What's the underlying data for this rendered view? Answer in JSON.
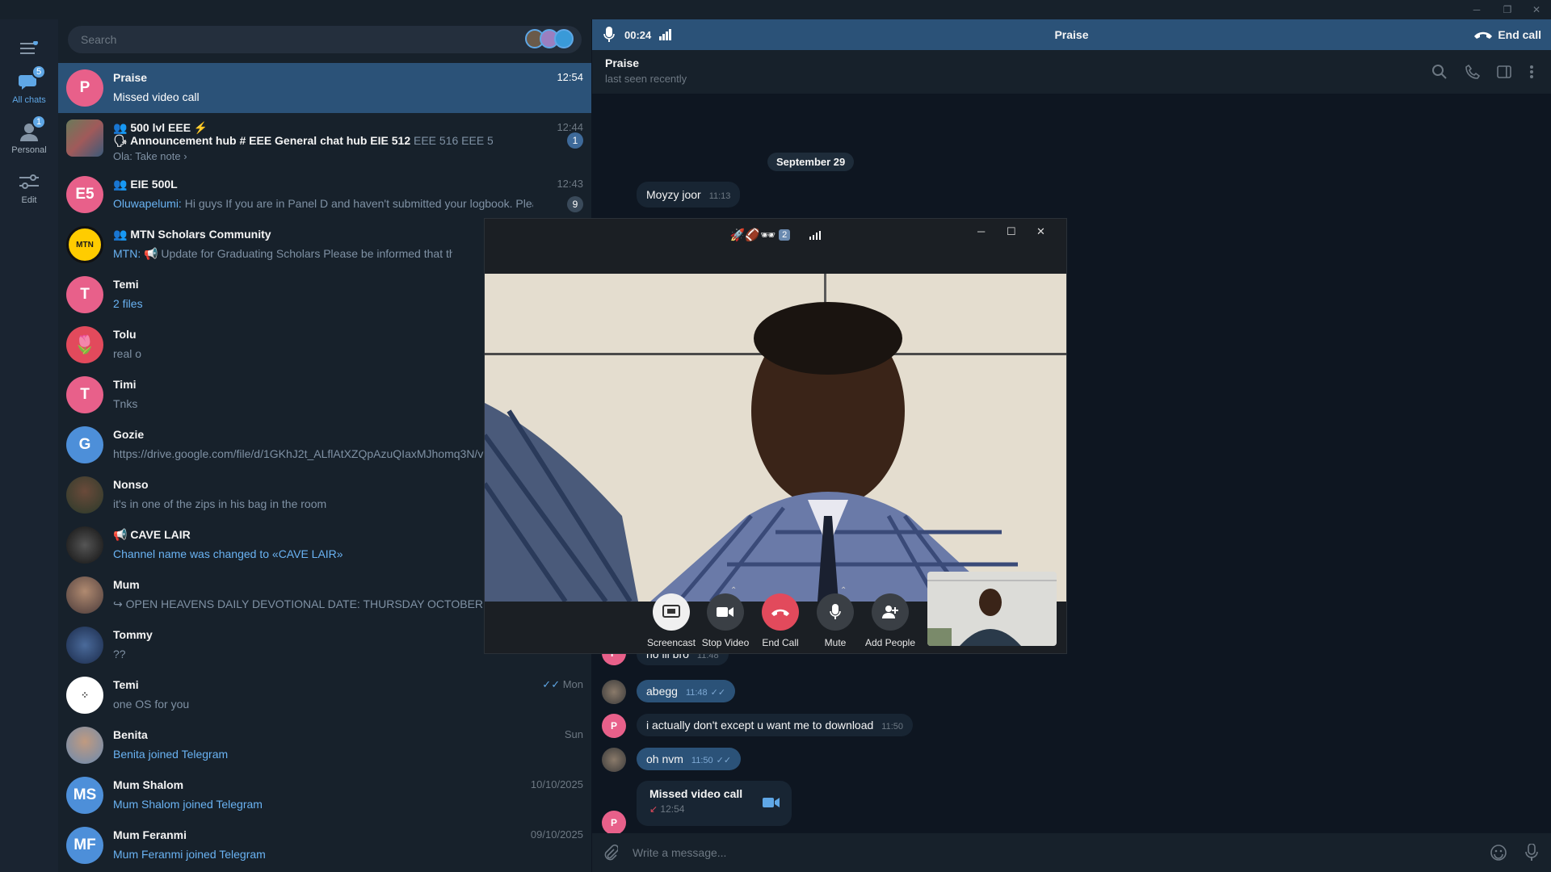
{
  "window": {
    "minimize": "─",
    "restore": "❐",
    "close": "✕"
  },
  "rail": {
    "items": [
      {
        "label": "All chats",
        "badge": "5"
      },
      {
        "label": "Personal",
        "badge": "1"
      },
      {
        "label": "Edit"
      }
    ]
  },
  "search": {
    "placeholder": "Search"
  },
  "chats": [
    {
      "name": "Praise",
      "preview": "Missed video call",
      "time": "12:54",
      "avatar_letter": "P",
      "avatar_color": "#e8608a"
    },
    {
      "name": "500 lvl EEE ⚡",
      "preview_prefix": "🗣 Announcement hub  # EEE General chat hub  EIE 512",
      "preview": "EEE 516  EEE 531  EEE 515  EDS ...",
      "sub_preview": "Ola: Take note ›",
      "time": "12:44",
      "unread": "1"
    },
    {
      "name": "EIE 500L",
      "preview_sender": "Oluwapelumi:",
      "preview": "Hi guys  If you are in Panel D and haven't submitted your logbook.  Please co...",
      "time": "12:43",
      "unread": "9",
      "avatar_letter": "E5",
      "avatar_color": "#e8608a"
    },
    {
      "name": "MTN Scholars Community",
      "preview_sender": "MTN:",
      "preview": "📢 Update for Graduating Scholars  Please be informed that the SkillUP",
      "avatar_letter": "MTN",
      "avatar_color": "#ffcc00"
    },
    {
      "name": "Temi",
      "preview": "2 files",
      "avatar_letter": "T",
      "avatar_color": "#e8608a"
    },
    {
      "name": "Tolu",
      "preview": "real o",
      "avatar_letter": "🌷",
      "avatar_color": "#e24a5c"
    },
    {
      "name": "Timi",
      "preview": "Tnks",
      "avatar_letter": "T",
      "avatar_color": "#e8608a"
    },
    {
      "name": "Gozie",
      "preview": "https://drive.google.com/file/d/1GKhJ2t_ALflAtXZQpAzuQIaxMJhomq3N/view",
      "avatar_letter": "G",
      "avatar_color": "#4d8fd9"
    },
    {
      "name": "Nonso",
      "preview": "it's in one of the zips in his bag in the room",
      "avatar_color": "#5a4a3a"
    },
    {
      "name": "📢 CAVE LAIR",
      "preview": "Channel name was changed to «CAVE LAIR»",
      "avatar_color": "#222"
    },
    {
      "name": "Mum",
      "preview": "↪ OPEN HEAVENS DAILY DEVOTIONAL   DATE: THURSDAY OCTOBER 16TH202",
      "avatar_color": "#8a6a5a"
    },
    {
      "name": "Tommy",
      "preview": "??",
      "avatar_color": "#3a4a6a"
    },
    {
      "name": "Temi",
      "preview": "one OS for you",
      "time": "Mon",
      "avatar_color": "#ffffff"
    },
    {
      "name": "Benita",
      "preview": "Benita joined Telegram",
      "time": "Sun",
      "avatar_color": "#7a6a8a"
    },
    {
      "name": "Mum Shalom",
      "preview": "Mum Shalom joined Telegram",
      "time": "10/10/2025",
      "avatar_letter": "MS",
      "avatar_color": "#4d8fd9"
    },
    {
      "name": "Mum Feranmi",
      "preview": "Mum Feranmi joined Telegram",
      "time": "09/10/2025",
      "avatar_letter": "MF",
      "avatar_color": "#4d8fd9"
    }
  ],
  "callbar": {
    "duration": "00:24",
    "title": "Praise",
    "end_label": "End call"
  },
  "chat_header": {
    "name": "Praise",
    "status": "last seen recently"
  },
  "messages": {
    "date": "September 29",
    "items": [
      {
        "text": "Moyzy joor",
        "time": "11:13",
        "out": false
      },
      {
        "text": "no lil bro",
        "time": "11:48",
        "out": false
      },
      {
        "text": "abegg",
        "time": "11:48",
        "out": true
      },
      {
        "text": "i actually don't except u want me to download",
        "time": "11:50",
        "out": false
      },
      {
        "text": "oh nvm",
        "time": "11:50",
        "out": true
      }
    ],
    "missed_call": {
      "title": "Missed video call",
      "time": "12:54"
    }
  },
  "composer": {
    "placeholder": "Write a message..."
  },
  "call_window": {
    "emojis": "🚀🏈🕶",
    "emoji_count": "2",
    "controls": [
      {
        "label": "Screencast"
      },
      {
        "label": "Stop Video"
      },
      {
        "label": "End Call"
      },
      {
        "label": "Mute"
      },
      {
        "label": "Add People"
      }
    ]
  },
  "colors": {
    "accent": "#5fa7e6",
    "active_row": "#2b5278",
    "end_call": "#e24a5c"
  }
}
